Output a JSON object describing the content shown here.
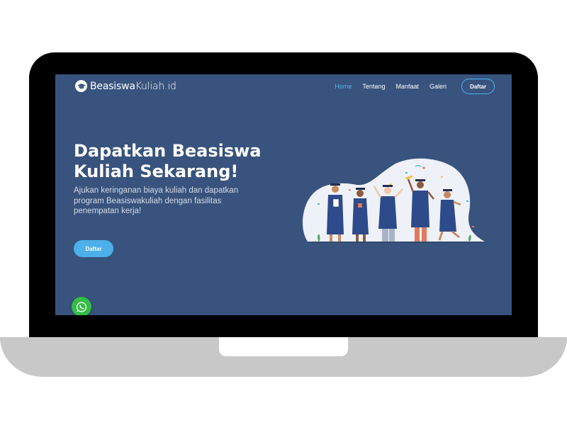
{
  "brand": {
    "name_bold": "Beasiswa",
    "name_light": "Kuliah.id",
    "logo_icon": "graduation-cap-icon"
  },
  "nav": {
    "links": [
      {
        "label": "Home",
        "active": true
      },
      {
        "label": "Tentang",
        "active": false
      },
      {
        "label": "Manfaat",
        "active": false
      },
      {
        "label": "Galeri",
        "active": false
      }
    ],
    "cta_label": "Daftar"
  },
  "hero": {
    "title_line1": "Dapatkan Beasiswa",
    "title_line2": "Kuliah Sekarang!",
    "subtitle": "Ajukan keringanan biaya kuliah dan dapatkan program Beasiswakuliah dengan fasilitas penempatan kerja!",
    "cta_label": "Daftar",
    "illustration_icon": "graduates-illustration-icon"
  },
  "floating": {
    "whatsapp_icon": "whatsapp-icon"
  },
  "colors": {
    "background": "#38537d",
    "accent": "#4fb3f0",
    "button": "#4cb0ea",
    "whatsapp": "#34bd45",
    "gown": "#2d4a8a"
  }
}
